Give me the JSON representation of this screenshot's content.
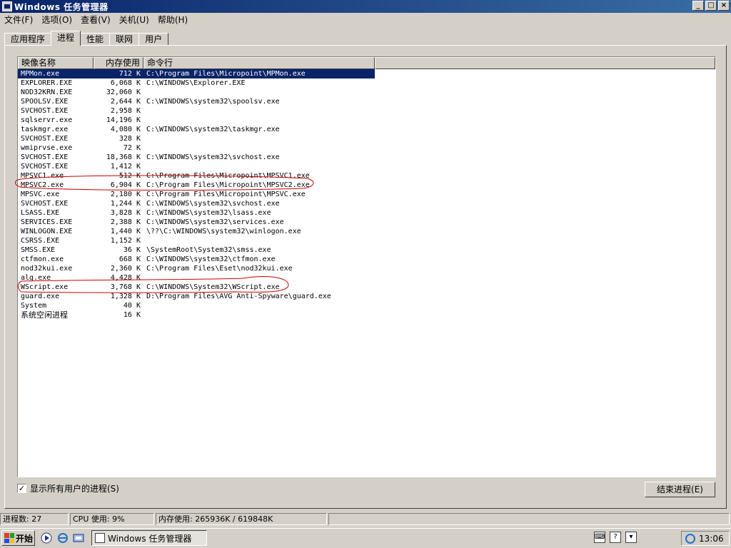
{
  "window": {
    "title": "Windows 任务管理器"
  },
  "menu": [
    "文件(F)",
    "选项(O)",
    "查看(V)",
    "关机(U)",
    "帮助(H)"
  ],
  "tabs": [
    "应用程序",
    "进程",
    "性能",
    "联网",
    "用户"
  ],
  "active_tab": "进程",
  "columns": {
    "name": "映像名称",
    "memory": "内存使用",
    "cmd": "命令行"
  },
  "processes": [
    {
      "name": "MPMon.exe",
      "mem": "712 K",
      "cmd": "C:\\Program Files\\Micropoint\\MPMon.exe",
      "selected": true
    },
    {
      "name": "EXPLORER.EXE",
      "mem": "6,068 K",
      "cmd": "C:\\WINDOWS\\Explorer.EXE"
    },
    {
      "name": "NOD32KRN.EXE",
      "mem": "32,060 K",
      "cmd": ""
    },
    {
      "name": "SPOOLSV.EXE",
      "mem": "2,644 K",
      "cmd": "C:\\WINDOWS\\system32\\spoolsv.exe"
    },
    {
      "name": "SVCHOST.EXE",
      "mem": "2,958 K",
      "cmd": ""
    },
    {
      "name": "sqlservr.exe",
      "mem": "14,196 K",
      "cmd": ""
    },
    {
      "name": "taskmgr.exe",
      "mem": "4,080 K",
      "cmd": "C:\\WINDOWS\\system32\\taskmgr.exe"
    },
    {
      "name": "SVCHOST.EXE",
      "mem": "328 K",
      "cmd": ""
    },
    {
      "name": "wmiprvse.exe",
      "mem": "72 K",
      "cmd": ""
    },
    {
      "name": "SVCHOST.EXE",
      "mem": "18,368 K",
      "cmd": "C:\\WINDOWS\\system32\\svchost.exe"
    },
    {
      "name": "SVCHOST.EXE",
      "mem": "1,412 K",
      "cmd": ""
    },
    {
      "name": "MPSVC1.exe",
      "mem": "512 K",
      "cmd": "C:\\Program Files\\Micropoint\\MPSVC1.exe"
    },
    {
      "name": "MPSVC2.exe",
      "mem": "6,904 K",
      "cmd": "C:\\Program Files\\Micropoint\\MPSVC2.exe"
    },
    {
      "name": "MPSVC.exe",
      "mem": "2,180 K",
      "cmd": "C:\\Program Files\\Micropoint\\MPSVC.exe"
    },
    {
      "name": "SVCHOST.EXE",
      "mem": "1,244 K",
      "cmd": "C:\\WINDOWS\\system32\\svchost.exe"
    },
    {
      "name": "LSASS.EXE",
      "mem": "3,828 K",
      "cmd": "C:\\WINDOWS\\system32\\lsass.exe"
    },
    {
      "name": "SERVICES.EXE",
      "mem": "2,388 K",
      "cmd": "C:\\WINDOWS\\system32\\services.exe"
    },
    {
      "name": "WINLOGON.EXE",
      "mem": "1,440 K",
      "cmd": "\\??\\C:\\WINDOWS\\system32\\winlogon.exe"
    },
    {
      "name": "CSRSS.EXE",
      "mem": "1,152 K",
      "cmd": ""
    },
    {
      "name": "SMSS.EXE",
      "mem": "36 K",
      "cmd": "\\SystemRoot\\System32\\smss.exe"
    },
    {
      "name": "ctfmon.exe",
      "mem": "668 K",
      "cmd": "C:\\WINDOWS\\system32\\ctfmon.exe"
    },
    {
      "name": "nod32kui.exe",
      "mem": "2,360 K",
      "cmd": "C:\\Program Files\\Eset\\nod32kui.exe"
    },
    {
      "name": "alg.exe",
      "mem": "4,428 K",
      "cmd": ""
    },
    {
      "name": "WScript.exe",
      "mem": "3,768 K",
      "cmd": "C:\\WINDOWS\\System32\\WScript.exe"
    },
    {
      "name": "guard.exe",
      "mem": "1,328 K",
      "cmd": "D:\\Program Files\\AVG Anti-Spyware\\guard.exe"
    },
    {
      "name": "System",
      "mem": "40 K",
      "cmd": ""
    },
    {
      "name": "系统空闲进程",
      "mem": "16 K",
      "cmd": ""
    }
  ],
  "show_all_users": {
    "label": "显示所有用户的进程(S)",
    "checked": true
  },
  "end_process_label": "结束进程(E)",
  "status": {
    "processes": "进程数: 27",
    "cpu": "CPU 使用: 9%",
    "memory": "内存使用: 265936K / 619848K"
  },
  "taskbar": {
    "start_label": "开始",
    "task_item": "Windows 任务管理器",
    "clock": "13:06"
  },
  "colors": {
    "selection": "#0a246a",
    "annotation": "#cc0000",
    "face": "#d4d0c8"
  }
}
